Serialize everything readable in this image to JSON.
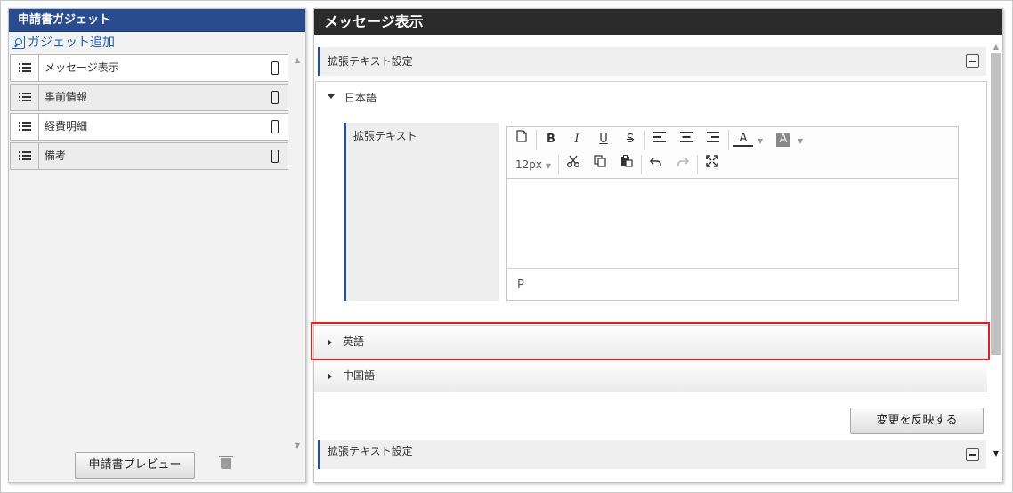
{
  "left_panel": {
    "title": "申請書ガジェット",
    "add_link": "ガジェット追加",
    "items": [
      {
        "label": "メッセージ表示",
        "icon": "list-icon",
        "device_icon": "smartphone-icon"
      },
      {
        "label": "事前情報",
        "icon": "list-icon",
        "device_icon": "smartphone-icon"
      },
      {
        "label": "経費明細",
        "icon": "list-icon",
        "device_icon": "smartphone-icon"
      },
      {
        "label": "備考",
        "icon": "list-icon",
        "device_icon": "smartphone-icon"
      }
    ],
    "preview_button": "申請書プレビュー",
    "delete_icon": "trash-icon"
  },
  "right_panel": {
    "title": "メッセージ表示",
    "section_title": "拡張テキスト設定",
    "languages": [
      {
        "label": "日本語",
        "expanded": true
      },
      {
        "label": "英語",
        "expanded": false
      },
      {
        "label": "中国語",
        "expanded": false
      }
    ],
    "field_label": "拡張テキスト",
    "editor": {
      "font_size": "12px",
      "status_path": "P",
      "toolbar_icons": [
        "new-document-icon",
        "bold-icon",
        "italic-icon",
        "underline-icon",
        "strikethrough-icon",
        "align-left-icon",
        "align-center-icon",
        "align-right-icon",
        "text-color-icon",
        "background-color-icon",
        "cut-icon",
        "copy-icon",
        "paste-icon",
        "undo-icon",
        "redo-icon",
        "fullscreen-icon"
      ],
      "bold": "B",
      "italic": "I",
      "underline": "U",
      "strike": "S",
      "text_color": "A",
      "bg_color": "A"
    },
    "apply_button": "変更を反映する",
    "next_section_title": "拡張テキスト設定"
  },
  "colors": {
    "header_blue": "#2b4b8f",
    "header_dark": "#2b2b2b",
    "highlight": "#e0201f"
  }
}
